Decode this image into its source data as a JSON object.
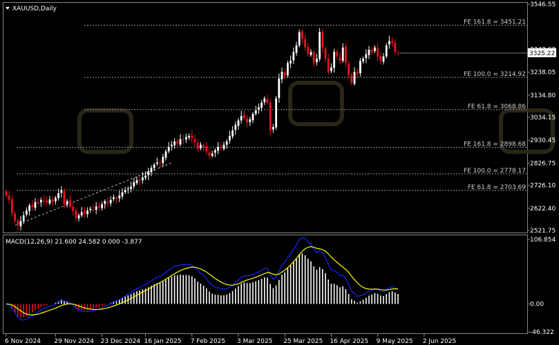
{
  "window": {
    "symbol_label": "XAUUSD,Daily"
  },
  "indicator": {
    "label": "MACD(12,26,9) 21.600 24.582 0.000 -3.877",
    "ticks": [
      {
        "label": "106.854",
        "value": 106.854
      },
      {
        "label": "0.00",
        "value": 0
      },
      {
        "label": "-46.322",
        "value": -46.322
      }
    ]
  },
  "colors": {
    "bull": "#ffffff",
    "bear": "#e8141e",
    "macd_line": "#1428ff",
    "signal_line": "#ffff00",
    "hist_pos": "#ffffff",
    "hist_neg": "#e8141e",
    "level_line": "#9a9a9a",
    "price_box": "#ffffff"
  },
  "price_axis": {
    "ticks": [
      {
        "label": "3546.55",
        "value": 3546.55
      },
      {
        "label": "3342.60",
        "value": 3342.6
      },
      {
        "label": "3238.05",
        "value": 3238.05
      },
      {
        "label": "3134.80",
        "value": 3134.8
      },
      {
        "label": "3034.15",
        "value": 3034.15
      },
      {
        "label": "2930.45",
        "value": 2930.45
      },
      {
        "label": "2826.75",
        "value": 2826.75
      },
      {
        "label": "2726.10",
        "value": 2726.1
      },
      {
        "label": "2622.40",
        "value": 2622.4
      },
      {
        "label": "2521.75",
        "value": 2521.75
      }
    ],
    "current_price": "3325.22",
    "current_value": 3325.22
  },
  "fib_levels": [
    {
      "label": "FE 161.8 = 3451.21",
      "value": 3451.21
    },
    {
      "label": "FE 100.0 = 3214.92",
      "value": 3214.92
    },
    {
      "label": "FE 61.8 = 3068.86",
      "value": 3068.86
    },
    {
      "label": "FE 161.8 = 2898.68",
      "value": 2898.68
    },
    {
      "label": "FE 100.0 = 2778.17",
      "value": 2778.17
    },
    {
      "label": "FE 61.8 = 2703.69",
      "value": 2703.69
    }
  ],
  "time_axis": {
    "labels": [
      {
        "label": "6 Nov 2024",
        "bar": 0
      },
      {
        "label": "29 Nov 2024",
        "bar": 17
      },
      {
        "label": "23 Dec 2024",
        "bar": 33
      },
      {
        "label": "16 Jan 2025",
        "bar": 48
      },
      {
        "label": "7 Feb 2025",
        "bar": 64
      },
      {
        "label": "3 Mar 2025",
        "bar": 80
      },
      {
        "label": "25 Mar 2025",
        "bar": 96
      },
      {
        "label": "16 Apr 2025",
        "bar": 112
      },
      {
        "label": "9 May 2025",
        "bar": 128
      },
      {
        "label": "2 Jun 2025",
        "bar": 144
      }
    ]
  },
  "chart_data": {
    "type": "candlestick",
    "symbol": "XAUUSD",
    "timeframe": "Daily",
    "ylim": [
      2521.75,
      3546.55
    ],
    "closes": [
      2680,
      2660,
      2600,
      2565,
      2545,
      2565,
      2590,
      2612,
      2635,
      2628,
      2650,
      2645,
      2660,
      2655,
      2648,
      2662,
      2650,
      2670,
      2690,
      2705,
      2640,
      2655,
      2630,
      2610,
      2580,
      2590,
      2605,
      2598,
      2612,
      2620,
      2615,
      2630,
      2625,
      2640,
      2655,
      2645,
      2660,
      2672,
      2665,
      2680,
      2695,
      2705,
      2712,
      2720,
      2740,
      2750,
      2745,
      2762,
      2770,
      2790,
      2805,
      2820,
      2830,
      2825,
      2855,
      2880,
      2900,
      2910,
      2925,
      2915,
      2935,
      2930,
      2945,
      2950,
      2940,
      2920,
      2890,
      2910,
      2900,
      2880,
      2860,
      2870,
      2885,
      2900,
      2895,
      2910,
      2925,
      2950,
      2975,
      3000,
      3020,
      3040,
      3030,
      3010,
      3025,
      3050,
      3065,
      3080,
      3100,
      3120,
      3100,
      2975,
      2990,
      3120,
      3210,
      3240,
      3220,
      3280,
      3290,
      3330,
      3360,
      3420,
      3390,
      3350,
      3320,
      3330,
      3280,
      3300,
      3420,
      3350,
      3300,
      3240,
      3260,
      3330,
      3310,
      3290,
      3350,
      3280,
      3225,
      3190,
      3240,
      3230,
      3290,
      3300,
      3320,
      3340,
      3330,
      3350,
      3310,
      3290,
      3310,
      3360,
      3380,
      3370,
      3330,
      3325
    ]
  }
}
